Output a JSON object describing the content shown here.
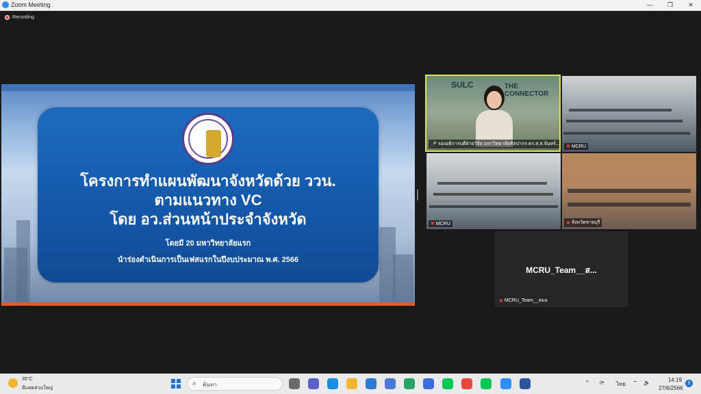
{
  "window": {
    "title": "Zoom Meeting",
    "minimize": "—",
    "restore": "❐",
    "close": "✕"
  },
  "recording": {
    "label": "Recording"
  },
  "slide": {
    "line1": "โครงการทำแผนพัฒนาจังหวัดด้วย ววน.",
    "line2": "ตามแนวทาง VC",
    "line3": "โดย อว.ส่วนหน้าประจำจังหวัด",
    "sub1": "โดยมี 20 มหาวิทยาลัยแรก",
    "sub2": "นำร่องดำเนินการเป็นเฟสแรกในปีงบประมาณ พ.ศ. 2566"
  },
  "tiles": [
    {
      "label": "รองอธิการบดีฝ่ายวิจัย มหาวิทยาลัยศิลปากร ดร.ส.ส.จันทร์...",
      "logo1": "SULC",
      "logo2": "THE CONNECTOR"
    },
    {
      "label": "MCRU"
    },
    {
      "label": "MCRU"
    },
    {
      "label": "จังหวัดชายบุรี"
    },
    {
      "label": "MCRU_Team__สมอ",
      "name": "MCRU_Team__ส..."
    }
  ],
  "taskbar": {
    "temperature": "35°C",
    "weather": "มีแดดส่วนใหญ่",
    "search_placeholder": "ค้นหา",
    "language": "ไทย",
    "time": "14:19",
    "date": "27/6/2566",
    "notifications": "5",
    "app_colors": [
      "#6b6b6b",
      "#5b5fc7",
      "#1a8fe0",
      "#f2b530",
      "#2b7bd1",
      "#4a7ad6",
      "#2aa36b",
      "#3b6ed8",
      "#06c755",
      "#e8483d",
      "#06c755",
      "#2d8cff",
      "#2b579a"
    ]
  }
}
